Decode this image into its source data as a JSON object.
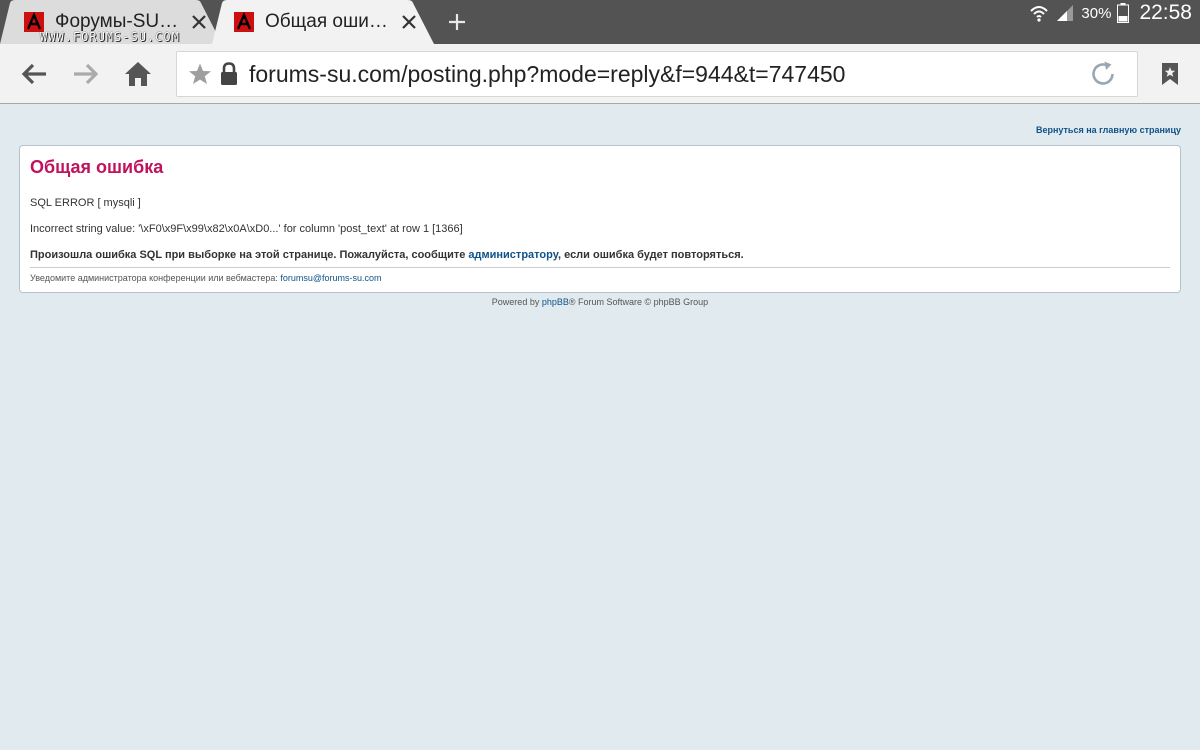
{
  "tabs": [
    {
      "title": "Форумы-SU…",
      "active": false,
      "favicon": "forums-su-logo-icon"
    },
    {
      "title": "Общая оши…",
      "active": true,
      "favicon": "forums-su-logo-icon"
    }
  ],
  "watermark": "WWW.FORUMS-SU.COM",
  "status_bar": {
    "battery_percent": "30%",
    "time": "22:58",
    "icons": [
      "wifi-icon",
      "signal-icon",
      "battery-icon"
    ]
  },
  "toolbar": {
    "url": "forums-su.com/posting.php?mode=reply&f=944&t=747450",
    "icons": [
      "back-arrow-icon",
      "forward-arrow-icon",
      "home-icon",
      "star-icon",
      "lock-icon",
      "reload-icon",
      "bookmarks-icon"
    ]
  },
  "page": {
    "return_link": "Вернуться на главную страницу",
    "error": {
      "title": "Общая ошибка",
      "sql_error": "SQL ERROR [ mysqli ]",
      "details": "Incorrect string value: '\\xF0\\x9F\\x99\\x82\\x0A\\xD0...' for column 'post_text' at row 1 [1366]",
      "message_before": "Произошла ошибка SQL при выборке на этой странице. Пожалуйста, сообщите ",
      "message_link": "администратору",
      "message_after": ", если ошибка будет повторяться.",
      "notify_text": "Уведомите администратора конференции или вебмастера: ",
      "notify_email": "forumsu@forums-su.com"
    },
    "footer": {
      "before": "Powered by ",
      "link": "phpBB",
      "after": "® Forum Software © phpBB Group"
    }
  },
  "colors": {
    "page_background": "#e1eaee",
    "error_title": "#c1125d",
    "link": "#105289",
    "tab_strip": "#535353",
    "toolbar": "#f2f2f2"
  }
}
